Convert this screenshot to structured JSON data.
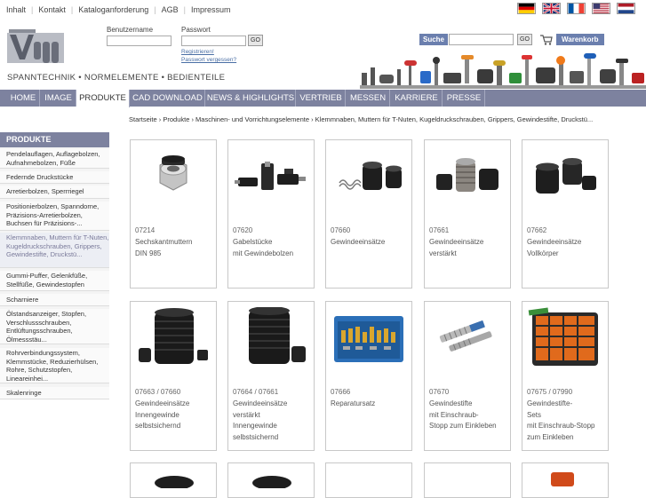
{
  "toplinks": [
    "Inhalt",
    "Kontakt",
    "Kataloganforderung",
    "AGB",
    "Impressum"
  ],
  "languages": [
    "de",
    "en",
    "fr",
    "us",
    "nl"
  ],
  "header": {
    "tagline": "SPANNTECHNIK • NORMELEMENTE • BEDIENTEILE"
  },
  "login": {
    "user_label": "Benutzername",
    "pass_label": "Passwort",
    "go": "GO",
    "register": "Registrieren!",
    "forgot": "Passwort vergessen?"
  },
  "search": {
    "button": "Suche",
    "go": "GO"
  },
  "cart": {
    "label": "Warenkorb"
  },
  "nav": [
    "HOME",
    "IMAGE",
    "PRODUKTE",
    "CAD DOWNLOAD",
    "NEWS & HIGHLIGHTS",
    "VERTRIEB",
    "MESSEN",
    "KARRIERE",
    "PRESSE"
  ],
  "nav_active": "PRODUKTE",
  "breadcrumb": "Startseite › Produkte › Maschinen- und Vorrichtungselemente › Klemmnaben, Muttern für T-Nuten, Kugeldruckschrauben, Grippers, Gewindestifte, Druckstü...",
  "sidebar": {
    "title": "PRODUKTE",
    "items": [
      {
        "label": "Pendelauflagen, Auflagebolzen, Aufnahmebolzen, Füße",
        "active": false
      },
      {
        "label": "Federnde Druckstücke",
        "active": false
      },
      {
        "label": "Arretierbolzen, Sperrriegel",
        "active": false
      },
      {
        "label": "Positionierbolzen, Spanndorne, Präzisions-Arretierbolzen, Buchsen für Präzisions-...",
        "active": false
      },
      {
        "label": "Klemmnaben, Muttern für T-Nuten, Kugeldruckschrauben, Grippers, Gewindestifte, Druckstü...",
        "active": true
      },
      {
        "label": "Gummi-Puffer, Gelenkfüße, Stellfüße, Gewindestopfen",
        "active": false
      },
      {
        "label": "Scharniere",
        "active": false
      },
      {
        "label": "Ölstandsanzeiger, Stopfen, Verschlussschrauben, Entlüftungsschrauben, Ölmessstäu...",
        "active": false
      },
      {
        "label": "Rohrverbindungssystem, Klemmstücke, Reduzierhülsen, Rohre, Schutzstopfen, Lineareinhei...",
        "active": false
      },
      {
        "label": "Skalenringe",
        "active": false
      }
    ]
  },
  "products": [
    {
      "code": "07214",
      "name": "Sechskantmuttern\nDIN 985",
      "image": "hex-nut"
    },
    {
      "code": "07620",
      "name": "Gabelstücke\nmit Gewindebolzen",
      "image": "fork-pieces"
    },
    {
      "code": "07660",
      "name": "Gewindeeinsätze",
      "image": "thread-inserts"
    },
    {
      "code": "07661",
      "name": "Gewindeeinsätze\nverstärkt",
      "image": "thread-inserts-reinforced"
    },
    {
      "code": "07662",
      "name": "Gewindeeinsätze\nVollkörper",
      "image": "thread-inserts-solid"
    },
    {
      "code": "07663 / 07660",
      "name": "Gewindeeinsätze\nInnengewinde\nselbstsichernd",
      "image": "thread-inserts-selflocking"
    },
    {
      "code": "07664 / 07661",
      "name": "Gewindeeinsätze\nverstärkt\nInnengewinde\nselbstsichernd",
      "image": "thread-inserts-reinforced-selflocking"
    },
    {
      "code": "07666",
      "name": "Reparatursatz",
      "image": "repair-kit"
    },
    {
      "code": "07670",
      "name": "Gewindestifte\nmit Einschraub-\nStopp zum Einkleben",
      "image": "threaded-pins"
    },
    {
      "code": "07675 / 07990",
      "name": "Gewindestifte-\nSets\nmit Einschraub-Stopp\nzum Einkleben",
      "image": "threaded-pin-set"
    }
  ],
  "colors": {
    "nav_bg": "#7d829f",
    "button_bg": "#6b7fae",
    "link": "#4a6fa5"
  }
}
